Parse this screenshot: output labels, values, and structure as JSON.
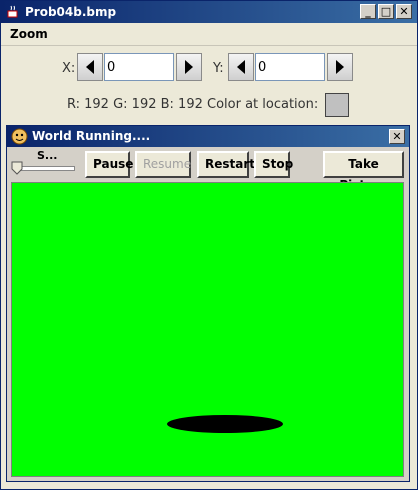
{
  "window": {
    "title": "Prob04b.bmp"
  },
  "menu": {
    "zoom": "Zoom"
  },
  "coords": {
    "x_label": "X:",
    "x_value": "0",
    "y_label": "Y:",
    "y_value": "0"
  },
  "color_info": {
    "text": "R: 192 G: 192 B: 192 Color at location:",
    "swatch_color": "#c0c0c0"
  },
  "world": {
    "title": "World Running....",
    "speed_label": "S...",
    "buttons": {
      "pause": "Pause",
      "resume": "Resume",
      "restart": "Restart",
      "stop": "Stop",
      "take_picture": "Take Picture"
    },
    "canvas_color": "#00ff00"
  }
}
